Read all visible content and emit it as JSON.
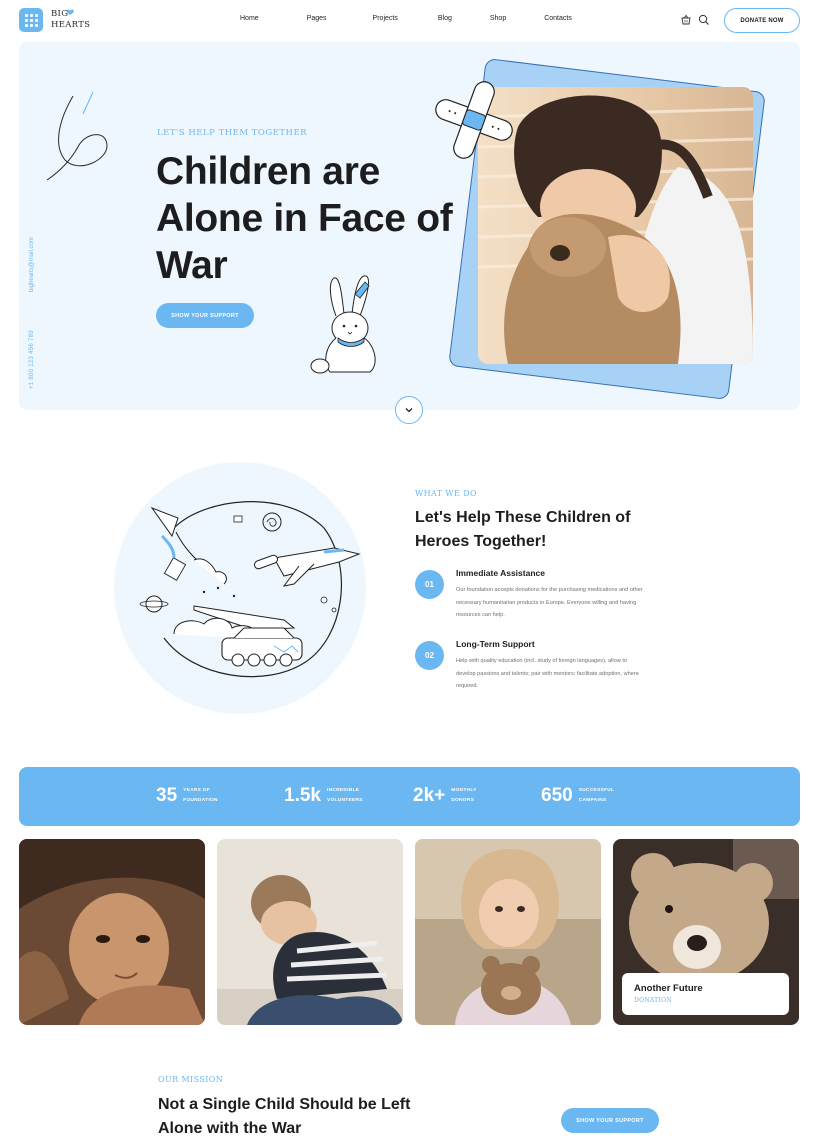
{
  "header": {
    "logo_text_line1": "BIG",
    "logo_text_line2": "HEARTS",
    "nav": [
      "Home",
      "Pages",
      "Projects",
      "Blog",
      "Shop",
      "Contacts"
    ],
    "donate_label": "DONATE NOW",
    "icons": [
      "grid-icon",
      "heart-icon",
      "basket-icon",
      "search-icon"
    ]
  },
  "hero": {
    "kicker": "LET'S HELP THEM TOGETHER",
    "title": "Children are Alone in Face of War",
    "button_label": "SHOW YOUR SUPPORT",
    "side_email": "bighearts@mail.com",
    "side_phone": "+1 800 123 456 789",
    "scroll_icon": "chevron-down-icon"
  },
  "what_we_do": {
    "kicker": "WHAT WE DO",
    "title": "Let's Help These Children of Heroes Together!",
    "features": [
      {
        "num": "01",
        "title": "Immediate Assistance",
        "desc": "Our foundation accepts donations for the purchasing medications and other necessary humanitarian products in Europe. Everyone willing and having resources can help."
      },
      {
        "num": "02",
        "title": "Long-Term Support",
        "desc": "Help with quality education (incl. study of foreign languages), allow to develop passions and talents; pair with mentors; facilitate adoption, where required."
      }
    ]
  },
  "stats": [
    {
      "value": "35",
      "label_line1": "YEARS OF",
      "label_line2": "FOUNDATION"
    },
    {
      "value": "1.5k",
      "label_line1": "INCREDIBLE",
      "label_line2": "VOLUNTEERS"
    },
    {
      "value": "2k+",
      "label_line1": "MONTHLY",
      "label_line2": "DONORS"
    },
    {
      "value": "650",
      "label_line1": "SUCCESSFUL",
      "label_line2": "CAMPAINS"
    }
  ],
  "gallery": {
    "card_title": "Another Future",
    "card_subtitle": "DONATION"
  },
  "mission": {
    "kicker": "OUR MISSION",
    "title": "Not a Single Child Should be Left Alone with the War",
    "button_label": "SHOW YOUR SUPPORT"
  },
  "colors": {
    "accent": "#6bb7f2",
    "hero_bg": "#eef7fd",
    "text": "#1d1d1f"
  }
}
